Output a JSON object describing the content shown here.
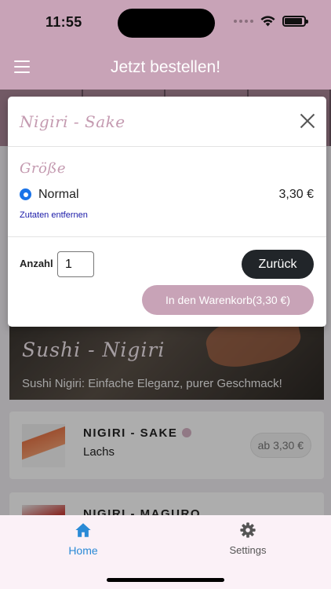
{
  "status_bar": {
    "time": "11:55"
  },
  "header": {
    "title": "Jetzt bestellen!",
    "menu_icon": "hamburger-menu-icon"
  },
  "background": {
    "hero_title": "Sushi - Nigiri",
    "hero_subtitle": "Sushi Nigiri: Einfache Eleganz, purer Geschmack!",
    "items": [
      {
        "name": "NIGIRI - SAKE",
        "description": "Lachs",
        "price": "ab 3,30 €"
      },
      {
        "name": "NIGIRI - MAGURO"
      }
    ]
  },
  "modal": {
    "title": "Nigiri - Sake",
    "size_heading": "Größe",
    "option_label": "Normal",
    "option_price": "3,30 €",
    "remove_ingredients": "Zutaten entfernen",
    "quantity_label": "Anzahl",
    "quantity_value": "1",
    "back_button": "Zurück",
    "cart_button": "In den Warenkorb(3,30 €)"
  },
  "bottom_nav": {
    "home_label": "Home",
    "settings_label": "Settings",
    "active_color": "#2a8ad6"
  },
  "colors": {
    "brand": "#c8a3b7",
    "dark_button": "#212529",
    "radio": "#1a73e8"
  }
}
